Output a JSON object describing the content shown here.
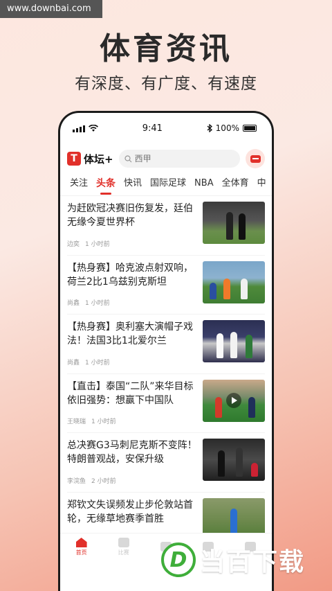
{
  "watermark": "www.downbai.com",
  "promo": {
    "title": "体育资讯",
    "subtitle": "有深度、有广度、有速度"
  },
  "status_bar": {
    "time": "9:41",
    "battery": "100%"
  },
  "app": {
    "logo_mark": "T",
    "name": "体坛+",
    "search_placeholder": "西甲"
  },
  "tabs": [
    {
      "label": "关注"
    },
    {
      "label": "头条"
    },
    {
      "label": "快讯"
    },
    {
      "label": "国际足球"
    },
    {
      "label": "NBA"
    },
    {
      "label": "全体育"
    },
    {
      "label": "中"
    }
  ],
  "active_tab": "头条",
  "feed": [
    {
      "title": "为赶欧冠决赛旧伤复发，廷伯无缘今夏世界杯",
      "author": "边奕",
      "time": "1 小时前"
    },
    {
      "title": "【热身赛】哈克波点射双响，荷兰2比1乌兹别克斯坦",
      "author": "尚鑫",
      "time": "1 小时前"
    },
    {
      "title": "【热身赛】奥利塞大演帽子戏法！法国3比1北爱尔兰",
      "author": "尚鑫",
      "time": "1 小时前"
    },
    {
      "title": "【直击】泰国“二队”来华目标依旧强势：想赢下中国队",
      "author": "王晓瑞",
      "time": "1 小时前"
    },
    {
      "title": "总决赛G3马刺尼克斯不变阵！特朗普观战，安保升级",
      "author": "李浣鱼",
      "time": "2 小时前"
    },
    {
      "title": "郑钦文失误频发止步伦敦站首轮，无缘草地赛季首胜",
      "author": "",
      "time": ""
    }
  ],
  "bottom_nav": [
    {
      "label": "首页",
      "active": true
    },
    {
      "label": "比赛",
      "active": false
    },
    {
      "label": "",
      "active": false
    },
    {
      "label": "",
      "active": false
    },
    {
      "label": "",
      "active": false
    }
  ],
  "brand": {
    "mark": "D",
    "text": "当百下载"
  },
  "colors": {
    "accent": "#e1302a",
    "brand_green": "#3fae3a"
  }
}
